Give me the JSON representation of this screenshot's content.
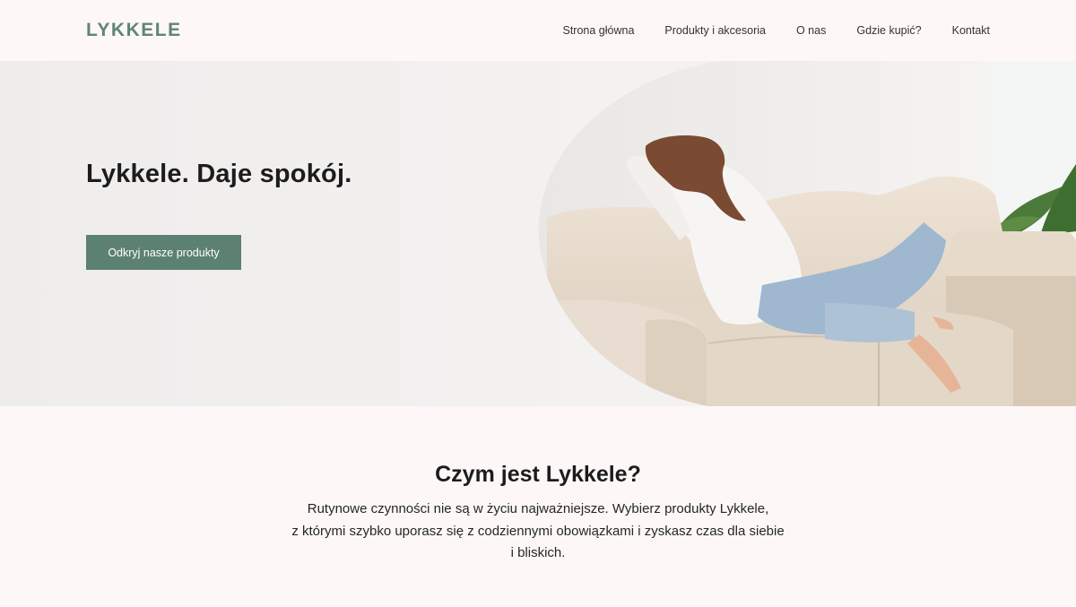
{
  "brand": {
    "logo": "LYKKELE",
    "accent_color": "#5c8172"
  },
  "nav": {
    "items": [
      {
        "label": "Strona główna"
      },
      {
        "label": "Produkty i akcesoria"
      },
      {
        "label": "O nas"
      },
      {
        "label": "Gdzie kupić?"
      },
      {
        "label": "Kontakt"
      }
    ]
  },
  "hero": {
    "title": "Lykkele. Daje spokój.",
    "cta_label": "Odkryj nasze produkty",
    "image_icon": "photo-woman-relaxing-on-sofa"
  },
  "about": {
    "title": "Czym jest Lykkele?",
    "lines": [
      "Rutynowe czynności nie są w życiu najważniejsze. Wybierz produkty Lykkele,",
      "z którymi szybko uporasz się z codziennymi obowiązkami i zyskasz czas dla siebie",
      "i bliskich."
    ]
  }
}
